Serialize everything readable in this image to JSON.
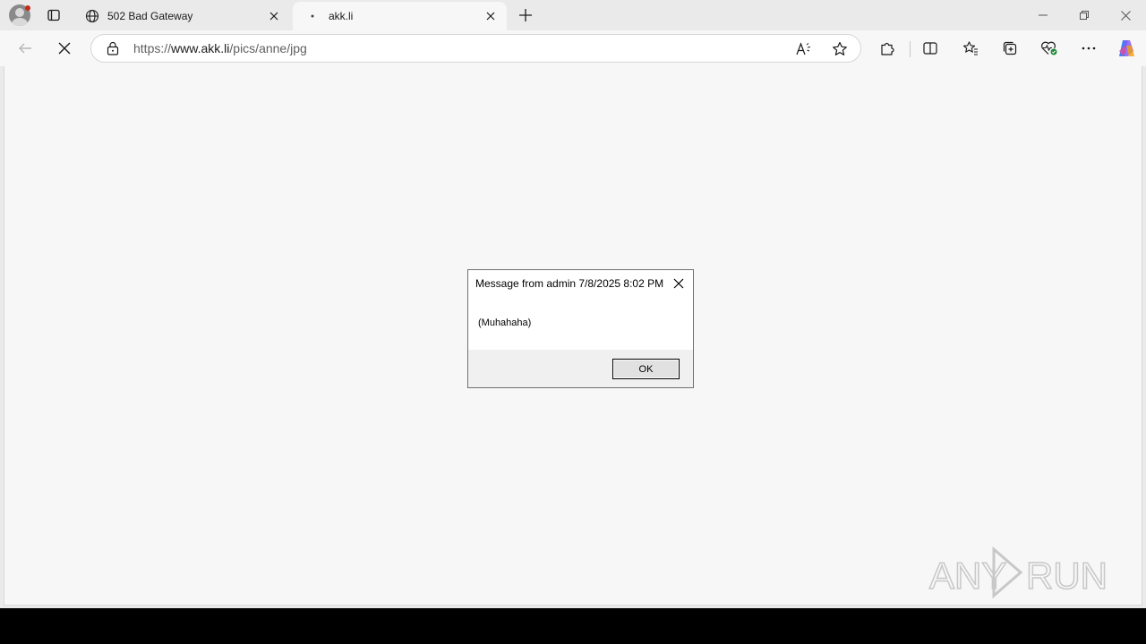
{
  "tabs": [
    {
      "title": "502 Bad Gateway",
      "icon": "globe-icon"
    },
    {
      "title": "akk.li",
      "icon": "loading-dot-icon",
      "active": true
    }
  ],
  "address": {
    "url_prefix": "https://",
    "url_host": "www.akk.li",
    "url_path": "/pics/anne/jpg"
  },
  "dialog": {
    "title": "Message from admin 7/8/2025 8:02 PM",
    "message": "(Muhahaha)",
    "ok_label": "OK"
  },
  "watermark": {
    "text_left": "ANY",
    "text_right": "RUN"
  },
  "colors": {
    "tab_strip": "#eaeaea",
    "content_bg": "#f7f7f7",
    "profile_dot": "#c42b1c"
  }
}
